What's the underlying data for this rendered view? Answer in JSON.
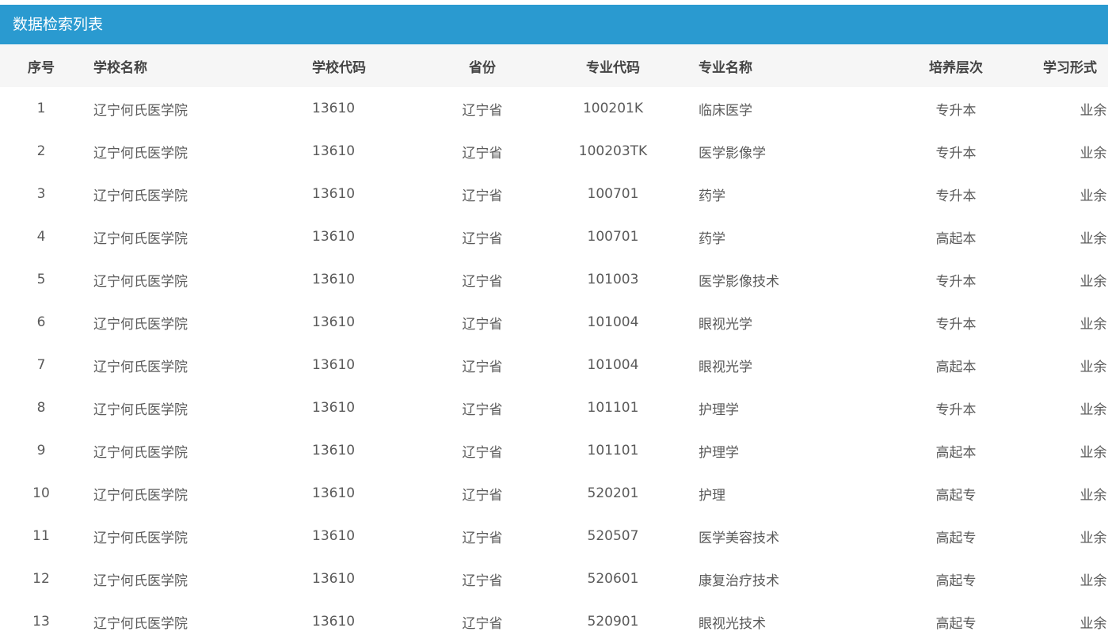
{
  "panel": {
    "title": "数据检索列表"
  },
  "table": {
    "headers": [
      "序号",
      "学校名称",
      "学校代码",
      "省份",
      "专业代码",
      "专业名称",
      "培养层次",
      "学习形式"
    ],
    "rows": [
      [
        "1",
        "辽宁何氏医学院",
        "13610",
        "辽宁省",
        "100201K",
        "临床医学",
        "专升本",
        "业余"
      ],
      [
        "2",
        "辽宁何氏医学院",
        "13610",
        "辽宁省",
        "100203TK",
        "医学影像学",
        "专升本",
        "业余"
      ],
      [
        "3",
        "辽宁何氏医学院",
        "13610",
        "辽宁省",
        "100701",
        "药学",
        "专升本",
        "业余"
      ],
      [
        "4",
        "辽宁何氏医学院",
        "13610",
        "辽宁省",
        "100701",
        "药学",
        "高起本",
        "业余"
      ],
      [
        "5",
        "辽宁何氏医学院",
        "13610",
        "辽宁省",
        "101003",
        "医学影像技术",
        "专升本",
        "业余"
      ],
      [
        "6",
        "辽宁何氏医学院",
        "13610",
        "辽宁省",
        "101004",
        "眼视光学",
        "专升本",
        "业余"
      ],
      [
        "7",
        "辽宁何氏医学院",
        "13610",
        "辽宁省",
        "101004",
        "眼视光学",
        "高起本",
        "业余"
      ],
      [
        "8",
        "辽宁何氏医学院",
        "13610",
        "辽宁省",
        "101101",
        "护理学",
        "专升本",
        "业余"
      ],
      [
        "9",
        "辽宁何氏医学院",
        "13610",
        "辽宁省",
        "101101",
        "护理学",
        "高起本",
        "业余"
      ],
      [
        "10",
        "辽宁何氏医学院",
        "13610",
        "辽宁省",
        "520201",
        "护理",
        "高起专",
        "业余"
      ],
      [
        "11",
        "辽宁何氏医学院",
        "13610",
        "辽宁省",
        "520507",
        "医学美容技术",
        "高起专",
        "业余"
      ],
      [
        "12",
        "辽宁何氏医学院",
        "13610",
        "辽宁省",
        "520601",
        "康复治疗技术",
        "高起专",
        "业余"
      ],
      [
        "13",
        "辽宁何氏医学院",
        "13610",
        "辽宁省",
        "520901",
        "眼视光技术",
        "高起专",
        "业余"
      ]
    ]
  },
  "colors": {
    "header_bar": "#2a9ad0",
    "table_head_bg": "#f6f6f6"
  }
}
